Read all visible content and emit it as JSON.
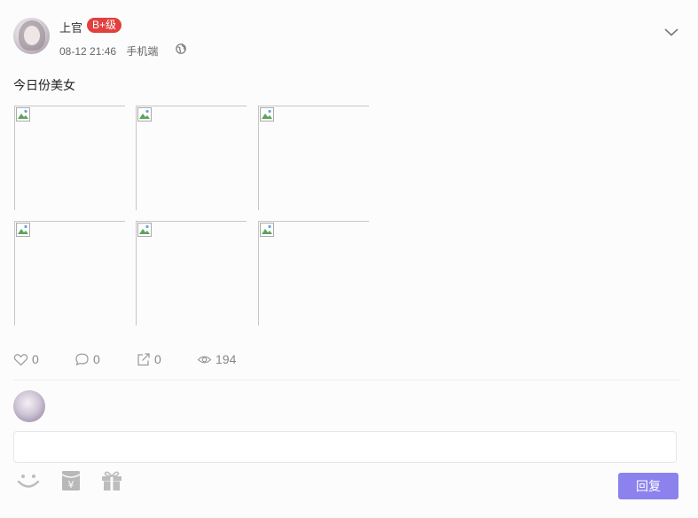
{
  "post": {
    "author": "上官",
    "level_badge": "B+级",
    "timestamp": "08-12 21:46",
    "device": "手机端",
    "visibility_icon": "globe-icon",
    "text": "今日份美女",
    "image_count": 6
  },
  "stats": {
    "likes": "0",
    "comments": "0",
    "shares": "0",
    "views": "194"
  },
  "reply": {
    "input_placeholder": "",
    "submit_label": "回复",
    "tools": [
      "smiley-icon",
      "red-envelope-icon",
      "gift-icon"
    ]
  },
  "colors": {
    "badge": "#e0413f",
    "reply_button": "#8b82ee",
    "muted": "#888888"
  }
}
